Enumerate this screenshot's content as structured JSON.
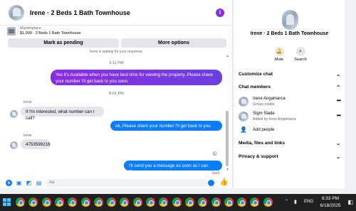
{
  "chat": {
    "title": "Irene · 2 Beds 1 Bath Townhouse",
    "marketplace_label": "Marketplace",
    "listing": "$1,000 · 2 Beds 1 Bath Townhouse",
    "mark_pending_label": "Mark as pending",
    "more_options_label": "More options",
    "waiting_note": "Irene is waiting for your response.",
    "timestamp1": "5:11 PM",
    "timestamp2": "8:01 PM",
    "messages": [
      {
        "direction": "out",
        "text": "Yes it's Available when you have best time for viewing the property..Please share your number I'll get back to you soon."
      },
      {
        "direction": "in",
        "sender": "Irene",
        "text": "If I'm interested, what number can I call?"
      },
      {
        "direction": "out",
        "text": "ok..Please share your number I'll get back to you soon."
      },
      {
        "direction": "in",
        "sender": "Irene",
        "text": "4753599216"
      },
      {
        "direction": "out",
        "text": "I'll send you a message as soon as I can. Thanks"
      }
    ],
    "sent_status": "Sent",
    "input_placeholder": "Aa"
  },
  "sidebar": {
    "name": "Irene · 2 Beds 1 Bath Townhouse",
    "mute_label": "Mute",
    "search_label": "Search",
    "customize": "Customize chat",
    "members_title": "Chat members",
    "members": [
      {
        "name": "Irene Angamarca",
        "role": "Group creator"
      },
      {
        "name": "Sigm Slade",
        "role": "Added by Irene Angamarca"
      }
    ],
    "add_people": "Add people",
    "media": "Media, files and links",
    "privacy": "Privacy & support"
  },
  "taskbar": {
    "language": "ENG",
    "time": "8:33 PM",
    "date": "6/18/2025"
  },
  "colors": {
    "accent": "#0a7cff",
    "purple_bubble": "#8b2be2",
    "info": "#8a2be2",
    "taskbar": "#202020"
  },
  "icons": [
    "info-icon",
    "mute-icon",
    "search-icon",
    "chevron-down-icon",
    "more-icon",
    "add-people-icon",
    "plus-icon",
    "image-icon",
    "sticker-icon",
    "gif-icon",
    "emoji-icon",
    "like-icon",
    "chrome-icon",
    "network-icon",
    "notification-icon"
  ]
}
